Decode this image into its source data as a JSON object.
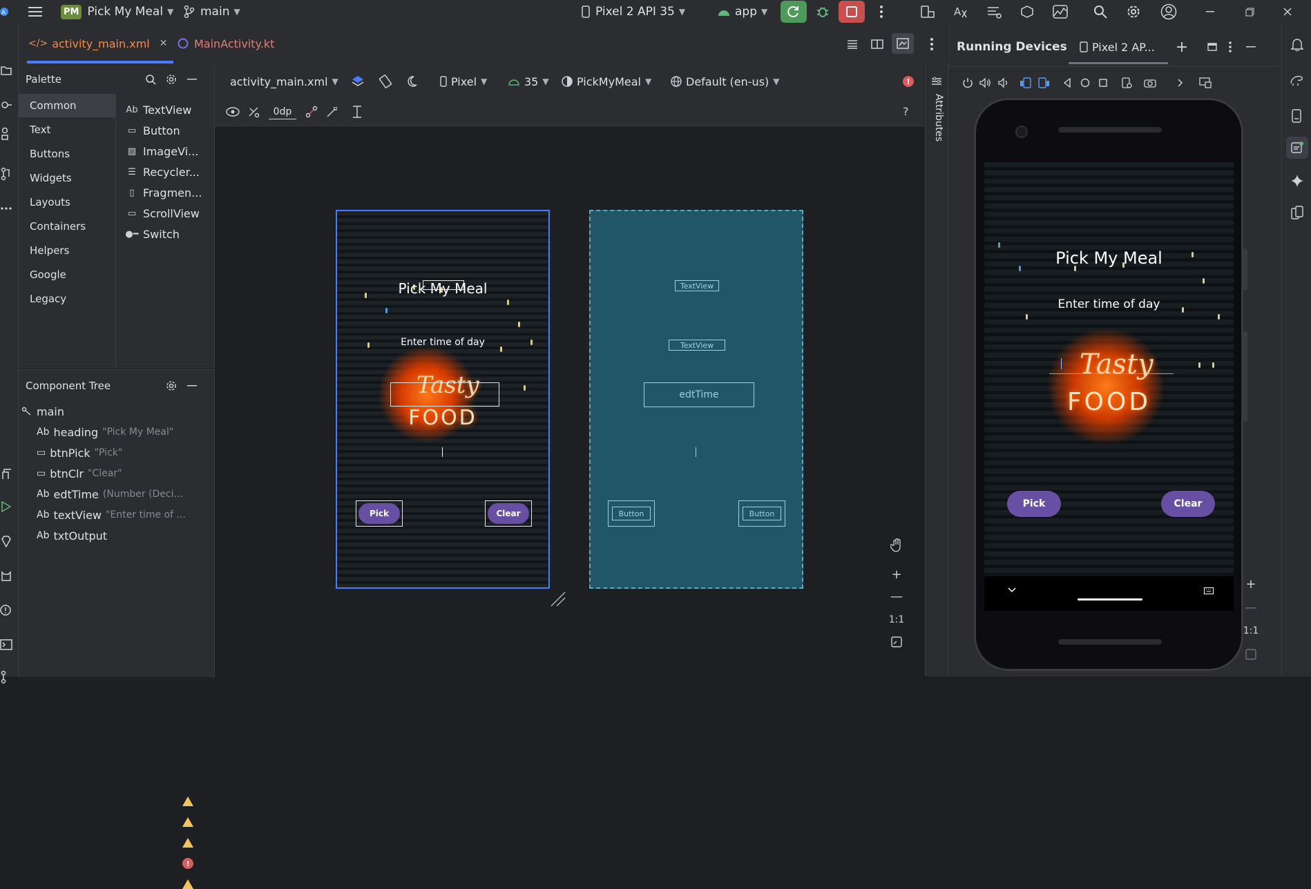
{
  "titlebar": {
    "project_badge": "PM",
    "project_name": "Pick My Meal",
    "branch": "main",
    "device": "Pixel 2 API 35",
    "run_config": "app"
  },
  "editor_tabs": [
    {
      "label": "activity_main.xml",
      "active": true
    },
    {
      "label": "MainActivity.kt",
      "active": false
    }
  ],
  "palette": {
    "title": "Palette",
    "categories": [
      "Common",
      "Text",
      "Buttons",
      "Widgets",
      "Layouts",
      "Containers",
      "Helpers",
      "Google",
      "Legacy"
    ],
    "widgets": [
      {
        "glyph": "Ab",
        "label": "TextView"
      },
      {
        "glyph": "▭",
        "label": "Button"
      },
      {
        "glyph": "▨",
        "label": "ImageVi..."
      },
      {
        "glyph": "☰",
        "label": "Recycler..."
      },
      {
        "glyph": "▯",
        "label": "Fragmen..."
      },
      {
        "glyph": "▭",
        "label": "ScrollView"
      },
      {
        "glyph": "●━",
        "label": "Switch"
      }
    ]
  },
  "component_tree": {
    "title": "Component Tree",
    "root": "main",
    "nodes": [
      {
        "glyph": "Ab",
        "id": "heading",
        "hint": "\"Pick My Meal\"",
        "status": "warning"
      },
      {
        "glyph": "▭",
        "id": "btnPick",
        "hint": "\"Pick\"",
        "status": "warning"
      },
      {
        "glyph": "▭",
        "id": "btnClr",
        "hint": "\"Clear\"",
        "status": "warning"
      },
      {
        "glyph": "Ab",
        "id": "edtTime",
        "hint": "(Number (Deci...",
        "status": "error"
      },
      {
        "glyph": "Ab",
        "id": "textView",
        "hint": "\"Enter time of ...",
        "status": "warning"
      },
      {
        "glyph": "Ab",
        "id": "txtOutput",
        "hint": "",
        "status": "none"
      }
    ]
  },
  "design_toolbar": {
    "file": "activity_main.xml",
    "device": "Pixel",
    "api": "35",
    "theme": "PickMyMeal",
    "locale": "Default (en-us)",
    "margin": "0dp"
  },
  "design_preview": {
    "heading": "Pick My Meal",
    "prompt": "Enter time of day",
    "neon_top": "Tasty",
    "neon_bottom": "FOOD",
    "btn_pick": "Pick",
    "btn_clear": "Clear"
  },
  "blueprint": {
    "tv1": "TextView",
    "tv2": "TextView",
    "edit": "edtTime",
    "btn1": "Button",
    "btn2": "Button"
  },
  "zoom": {
    "ratio": "1:1"
  },
  "attributes_label": "Attributes",
  "running_devices": {
    "title": "Running Devices",
    "tab": "Pixel 2 AP...",
    "app_heading": "Pick My Meal",
    "app_prompt": "Enter time of day",
    "btn_pick": "Pick",
    "btn_clear": "Clear",
    "zoom_ratio": "1:1"
  },
  "colors": {
    "accent": "#4b7bff",
    "button": "#6750a4",
    "warning": "#f2c55c",
    "error": "#db5c5c",
    "blueprint": "#215666",
    "run_green": "#4e9a5a",
    "stop_red": "#c94f4f"
  }
}
